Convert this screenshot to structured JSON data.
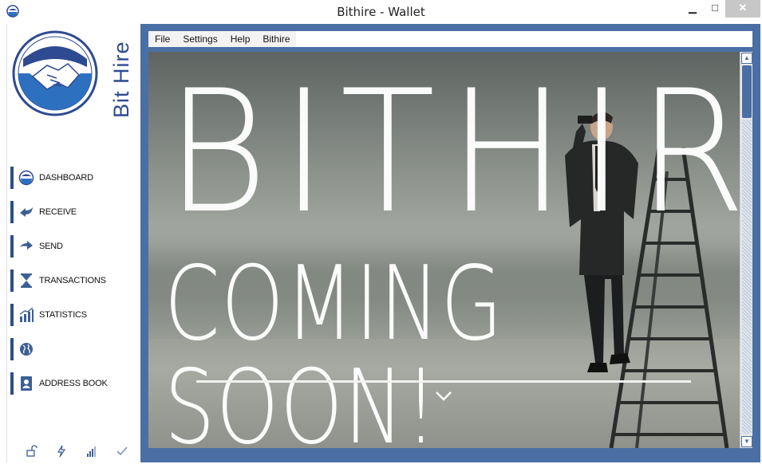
{
  "window": {
    "title": "Bithire - Wallet",
    "minimize_label": "▁",
    "maximize_label": "□",
    "close_label": "✕"
  },
  "sidebar": {
    "logo_text": "Bit Hire",
    "items": [
      {
        "label": "DASHBOARD",
        "icon": "dashboard-icon"
      },
      {
        "label": "RECEIVE",
        "icon": "receive-arrow-icon"
      },
      {
        "label": "SEND",
        "icon": "send-arrow-icon"
      },
      {
        "label": "TRANSACTIONS",
        "icon": "hourglass-icon"
      },
      {
        "label": "STATISTICS",
        "icon": "bar-chart-icon"
      },
      {
        "label": "",
        "icon": "globe-icon"
      },
      {
        "label": "ADDRESS BOOK",
        "icon": "address-book-icon"
      }
    ],
    "status_icons": [
      "lock-icon",
      "lightning-icon",
      "signal-icon",
      "check-icon"
    ]
  },
  "menubar": {
    "items": [
      "File",
      "Settings",
      "Help",
      "Bithire"
    ]
  },
  "content": {
    "hero_title": "BITHIRE",
    "hero_subtitle": "COMING SOON!"
  },
  "colors": {
    "accent": "#4a6fa5",
    "nav_bar": "#2d4f85",
    "logo_blue": "#2e4a91"
  }
}
